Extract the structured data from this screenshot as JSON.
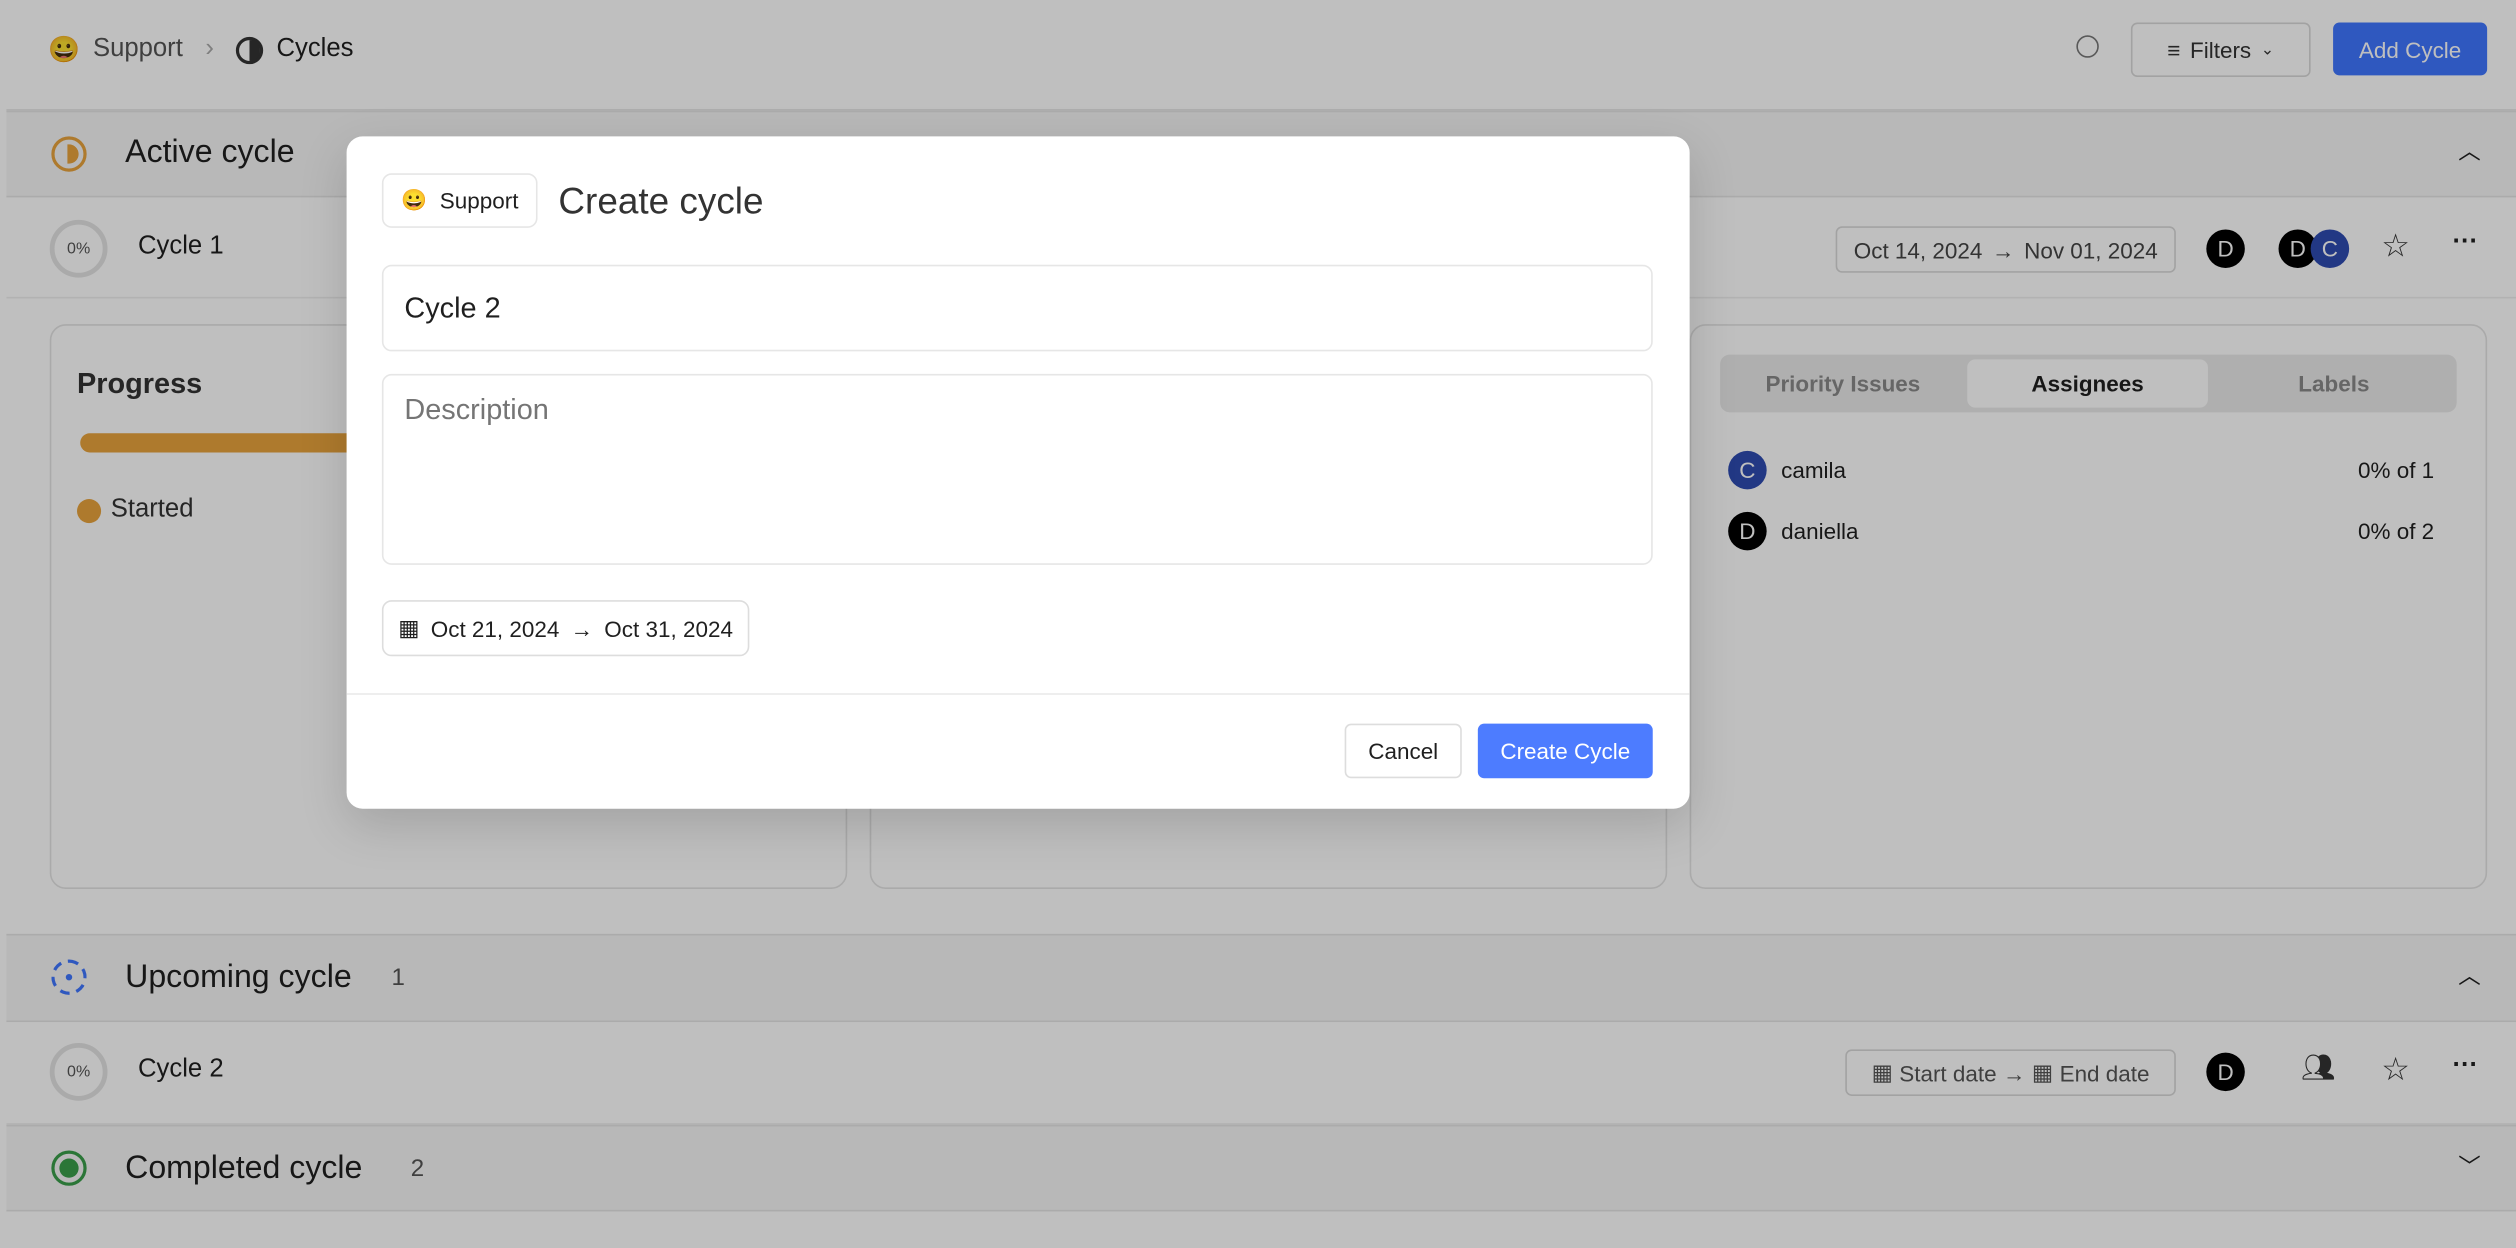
{
  "header": {
    "project": "Support",
    "project_emoji": "😀",
    "page": "Cycles",
    "filters_label": "Filters",
    "add_cycle_label": "Add Cycle"
  },
  "active": {
    "title": "Active cycle",
    "cycle": {
      "progress": "0%",
      "name": "Cycle 1",
      "start": "Oct 14, 2024",
      "end": "Nov 01, 2024"
    },
    "progress_card": {
      "title": "Progress",
      "legend": "Started",
      "started_color": "#e8a33d"
    },
    "tabs": [
      "Priority Issues",
      "Assignees",
      "Labels"
    ],
    "active_tab": "Assignees",
    "assignees": [
      {
        "initial": "C",
        "name": "camila",
        "stat": "0% of 1",
        "color": "#2e4bb0"
      },
      {
        "initial": "D",
        "name": "daniella",
        "stat": "0% of 2",
        "color": "#000000"
      }
    ]
  },
  "upcoming": {
    "title": "Upcoming cycle",
    "count": "1",
    "cycle": {
      "progress": "0%",
      "name": "Cycle 2",
      "start": "Start date",
      "end": "End date"
    }
  },
  "completed": {
    "title": "Completed cycle",
    "count": "2"
  },
  "modal": {
    "project": "Support",
    "project_emoji": "😀",
    "title": "Create cycle",
    "name_value": "Cycle 2",
    "description_placeholder": "Description",
    "start": "Oct 21, 2024",
    "end": "Oct 31, 2024",
    "cancel": "Cancel",
    "submit": "Create Cycle"
  },
  "colors": {
    "accent": "#3f76ff",
    "active": "#e8a33d",
    "upcoming": "#3f76ff",
    "completed": "#3a9e4a"
  }
}
